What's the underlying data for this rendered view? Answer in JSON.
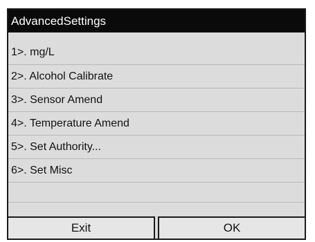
{
  "window": {
    "title": "AdvancedSettings"
  },
  "menu": {
    "items": [
      {
        "label": "1>. mg/L"
      },
      {
        "label": "2>. Alcohol Calibrate"
      },
      {
        "label": "3>. Sensor Amend"
      },
      {
        "label": "4>. Temperature Amend"
      },
      {
        "label": "5>. Set Authority..."
      },
      {
        "label": "6>. Set Misc"
      }
    ]
  },
  "buttons": {
    "exit_label": "Exit",
    "ok_label": "OK"
  },
  "colors": {
    "titlebar_bg": "#0a0a0a",
    "panel_bg": "#dcdcdc"
  }
}
